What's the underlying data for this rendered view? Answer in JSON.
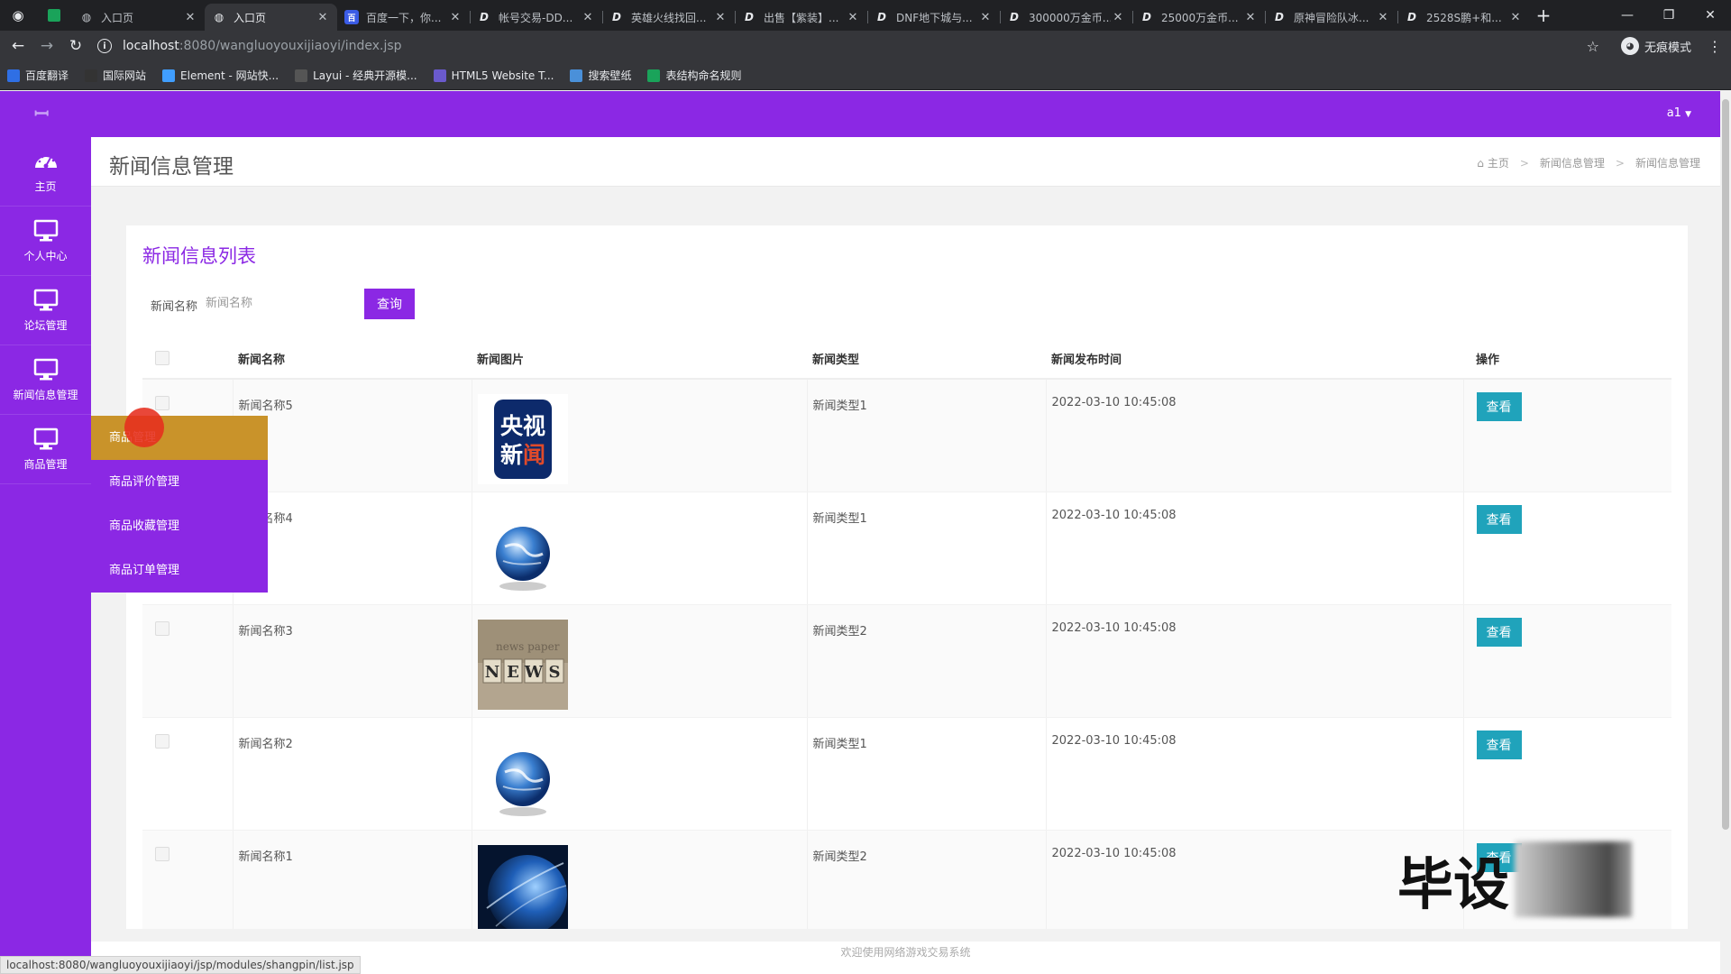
{
  "browser": {
    "tabs": [
      {
        "title": "入口页",
        "fav": "globe",
        "active": false
      },
      {
        "title": "入口页",
        "fav": "globe",
        "active": true
      },
      {
        "title": "百度一下，你...",
        "fav": "baidu",
        "active": false
      },
      {
        "title": "帐号交易-DD...",
        "fav": "D",
        "active": false
      },
      {
        "title": "英雄火线找回...",
        "fav": "D",
        "active": false
      },
      {
        "title": "出售【紫装】...",
        "fav": "D",
        "active": false
      },
      {
        "title": "DNF地下城与...",
        "fav": "D",
        "active": false
      },
      {
        "title": "300000万金币...",
        "fav": "D",
        "active": false
      },
      {
        "title": "25000万金币...",
        "fav": "D",
        "active": false
      },
      {
        "title": "原神冒险队冰...",
        "fav": "D",
        "active": false
      },
      {
        "title": "2528S鹏+和...",
        "fav": "D",
        "active": false
      }
    ],
    "url_host": "localhost",
    "url_path": ":8080/wangluoyouxijiaoyi/index.jsp",
    "profile_label": "无痕模式",
    "bookmarks": [
      "百度翻译",
      "国际网站",
      "Element - 网站快...",
      "Layui - 经典开源模...",
      "HTML5 Website T...",
      "搜索壁纸",
      "表结构命名规则"
    ],
    "status_url": "localhost:8080/wangluoyouxijiaoyi/jsp/modules/shangpin/list.jsp"
  },
  "app": {
    "user": "a1",
    "sidebar": [
      {
        "label": "主页",
        "icon": "dashboard-icon"
      },
      {
        "label": "个人中心",
        "icon": "monitor-icon"
      },
      {
        "label": "论坛管理",
        "icon": "monitor-icon"
      },
      {
        "label": "新闻信息管理",
        "icon": "monitor-icon"
      },
      {
        "label": "商品管理",
        "icon": "monitor-icon"
      }
    ],
    "flyout": [
      "商品管理",
      "商品评价管理",
      "商品收藏管理",
      "商品订单管理"
    ],
    "page_title": "新闻信息管理",
    "breadcrumb": [
      "主页",
      "新闻信息管理",
      "新闻信息管理"
    ],
    "card_title": "新闻信息列表",
    "search": {
      "label": "新闻名称",
      "placeholder": "新闻名称",
      "button": "查询"
    },
    "table": {
      "headers": [
        "新闻名称",
        "新闻图片",
        "新闻类型",
        "新闻发布时间",
        "操作"
      ],
      "rows": [
        {
          "name": "新闻名称5",
          "image": "cctv-news-logo",
          "type": "新闻类型1",
          "time": "2022-03-10 10:45:08",
          "action": "查看"
        },
        {
          "name": "新闻名称4",
          "image": "globe-news",
          "type": "新闻类型1",
          "time": "2022-03-10 10:45:08",
          "action": "查看"
        },
        {
          "name": "新闻名称3",
          "image": "news-blocks",
          "type": "新闻类型2",
          "time": "2022-03-10 10:45:08",
          "action": "查看"
        },
        {
          "name": "新闻名称2",
          "image": "globe-news",
          "type": "新闻类型1",
          "time": "2022-03-10 10:45:08",
          "action": "查看"
        },
        {
          "name": "新闻名称1",
          "image": "blue-globe",
          "type": "新闻类型2",
          "time": "2022-03-10 10:45:08",
          "action": "查看"
        }
      ]
    },
    "thumb_texts": {
      "cctv_top": "央视",
      "cctv_bottom": "新闻",
      "news_letters": [
        "N",
        "E",
        "W",
        "S"
      ]
    },
    "footer": "欢迎使用网络游戏交易系统",
    "watermark": "毕设",
    "colors": {
      "primary": "#8b28e4",
      "view_button": "#20a3bb",
      "menu_hover": "#c9932a"
    }
  }
}
